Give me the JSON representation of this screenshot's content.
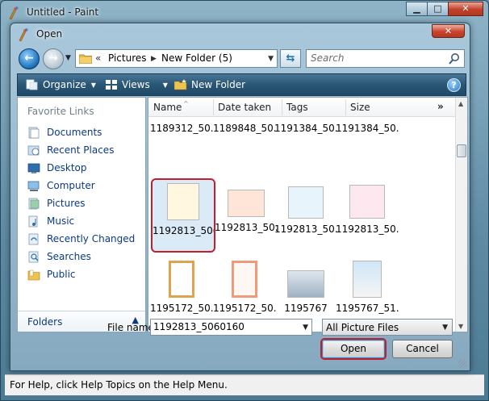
{
  "paint": {
    "title": "Untitled - Paint",
    "status_text": "For Help, click Help Topics on the Help Menu.",
    "minimize_glyph": "▁",
    "maximize_glyph": "□",
    "close_glyph": "✕"
  },
  "dialog": {
    "title": "Open",
    "close_glyph": "✕"
  },
  "address_bar": {
    "chevron": "«",
    "crumbs": [
      "Pictures",
      "New Folder (5)"
    ],
    "separator_glyph": "▶",
    "dropdown_glyph": "▼"
  },
  "navigation": {
    "back_glyph": "←",
    "forward_glyph": "→",
    "history_glyph": "▼",
    "refresh_glyph": "⇆"
  },
  "search": {
    "placeholder": "Search"
  },
  "toolbar": {
    "organize_label": "Organize",
    "views_label": "Views",
    "new_folder_label": "New Folder",
    "arrow_glyph": "▼",
    "help_glyph": "?"
  },
  "favorite_links": {
    "title": "Favorite Links",
    "items": [
      {
        "label": "Documents",
        "icon": "documents-icon"
      },
      {
        "label": "Recent Places",
        "icon": "recent-places-icon"
      },
      {
        "label": "Desktop",
        "icon": "desktop-icon"
      },
      {
        "label": "Computer",
        "icon": "computer-icon"
      },
      {
        "label": "Pictures",
        "icon": "pictures-icon"
      },
      {
        "label": "Music",
        "icon": "music-icon"
      },
      {
        "label": "Recently Changed",
        "icon": "recently-changed-icon"
      },
      {
        "label": "Searches",
        "icon": "searches-icon"
      },
      {
        "label": "Public",
        "icon": "public-icon"
      }
    ],
    "folders_label": "Folders",
    "folders_toggle_glyph": "▲"
  },
  "file_list": {
    "columns": [
      "Name",
      "Date taken",
      "Tags",
      "Size"
    ],
    "more_glyph": "»",
    "sort_glyph": "^",
    "top_row": [
      "1189312_50...",
      "1189848_50...",
      "1191384_50...",
      "1191384_50..."
    ],
    "row2": [
      "1192813_5060160",
      "1192813_50...",
      "1192813_50...",
      "1192813_50..."
    ],
    "row3": [
      "1195172_50...",
      "1195172_50...",
      "1195767",
      "1195767_51..."
    ],
    "scroll_up_glyph": "▲",
    "scroll_down_glyph": "▼"
  },
  "file_name": {
    "label": "File name:",
    "value": "1192813_5060160",
    "dropdown_glyph": "▼"
  },
  "file_type": {
    "value": "All Picture Files",
    "dropdown_glyph": "▼"
  },
  "buttons": {
    "open": "Open",
    "cancel": "Cancel"
  }
}
